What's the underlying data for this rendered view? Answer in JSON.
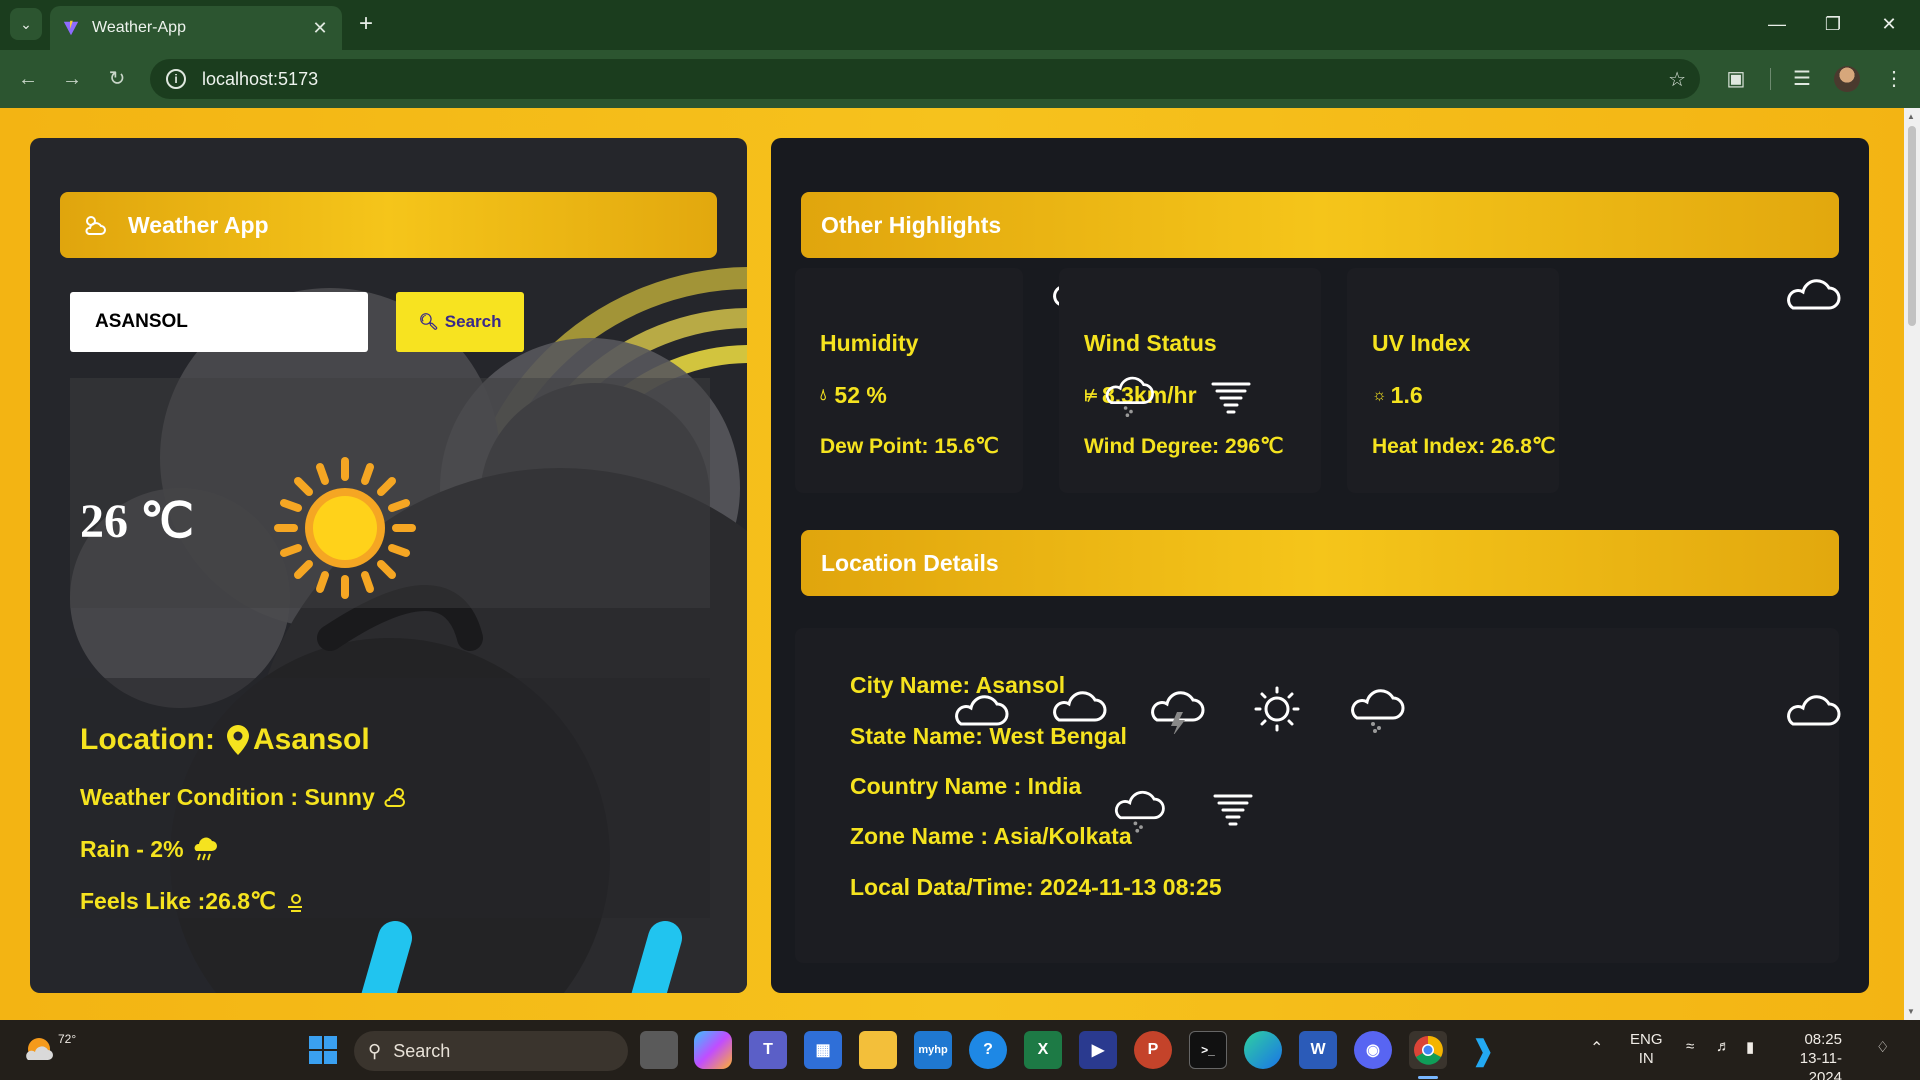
{
  "browser": {
    "tab_title": "Weather-App",
    "url": "localhost:5173"
  },
  "app": {
    "title": "Weather App",
    "search": {
      "value": "ASANSOL",
      "button_label": "Search"
    },
    "current": {
      "temperature": "26 ℃",
      "location_label": "Location:",
      "location_value": "Asansol",
      "condition": "Weather Condition : Sunny",
      "rain": "Rain - 2%",
      "feels_like": "Feels Like :26.8℃"
    }
  },
  "highlights": {
    "title": "Other Highlights",
    "cards": [
      {
        "title": "Humidity",
        "value": "52 %",
        "sub": "Dew Point: 15.6℃",
        "icon": "droplet-icon"
      },
      {
        "title": "Wind Status",
        "value": "8.3km/hr",
        "sub": "Wind Degree: 296℃",
        "icon": "thermometer-icon"
      },
      {
        "title": "UV Index",
        "value": "1.6",
        "sub": "Heat Index: 26.8℃",
        "icon": "sun-small-icon"
      }
    ]
  },
  "location_details": {
    "title": "Location Details",
    "lines": [
      "City Name: Asansol",
      "State Name: West Bengal",
      "Country Name : India",
      "Zone Name : Asia/Kolkata",
      "Local Data/Time: 2024-11-13 08:25"
    ]
  },
  "taskbar": {
    "weather_temp": "72°",
    "search_placeholder": "Search",
    "lang_top": "ENG",
    "lang_bottom": "IN",
    "time": "08:25",
    "date": "13-11-2024"
  },
  "colors": {
    "page_background": "#f6c21d",
    "panel_background": "#1d1e24",
    "accent_text": "#f5e31f",
    "header_bar": "#f2be17",
    "search_button": "#f7e320",
    "browser_frame": "#2c5530"
  }
}
